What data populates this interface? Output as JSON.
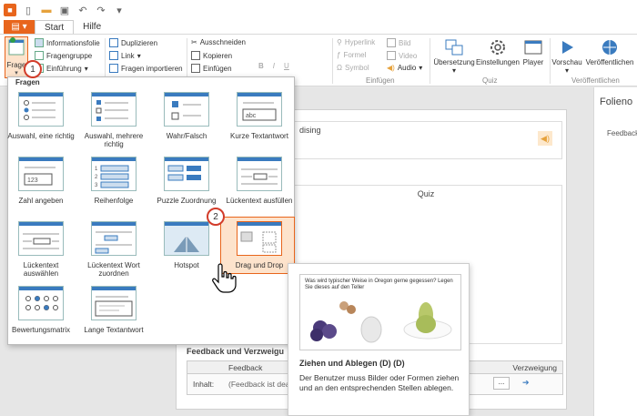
{
  "tabs": {
    "start": "Start",
    "help": "Hilfe"
  },
  "ribbon": {
    "question_btn": "Frage",
    "info_slide": "Informationsfolie",
    "question_group": "Fragengruppe",
    "intro": "Einführung",
    "duplicate": "Duplizieren",
    "link": "Link",
    "import_questions": "Fragen importieren",
    "cut": "Ausschneiden",
    "copy": "Kopieren",
    "paste": "Einfügen",
    "hyperlink": "Hyperlink",
    "formula": "Formel",
    "symbol": "Symbol",
    "image": "Bild",
    "video": "Video",
    "audio": "Audio",
    "insert_group": "Einfügen",
    "translation": "Übersetzung",
    "settings": "Einstellungen",
    "player": "Player",
    "quiz_group": "Quiz",
    "preview": "Vorschau",
    "publish": "Veröffentlichen",
    "publish_group": "Veröffentlichen",
    "bold": "B",
    "italic": "I",
    "underline": "U"
  },
  "panel": {
    "title": "Fragen",
    "tiles": [
      "Auswahl, eine richtig",
      "Auswahl, mehrere richtig",
      "Wahr/Falsch",
      "Kurze Textantwort",
      "Zahl angeben",
      "Reihenfolge",
      "Puzzle Zuordnung",
      "Lückentext ausfüllen",
      "Lückentext auswählen",
      "Lückentext Wort zuordnen",
      "Hotspot",
      "Drag und Drop",
      "Bewertungsmatrix",
      "Lange Textantwort"
    ]
  },
  "markers": {
    "one": "1",
    "two": "2"
  },
  "slide": {
    "partial_text": "dising",
    "quiz_label": "Quiz",
    "feedback_title": "Feedback und Verzweigu",
    "feedback_col": "Feedback",
    "branch_col": "Verzweigung",
    "content_label": "Inhalt:",
    "content_placeholder": "(Feedback ist dea",
    "dots_btn": "...",
    "arrow": "➔"
  },
  "right_panel": {
    "title": "Folieno",
    "feedback": "Feedback"
  },
  "tooltip": {
    "question": "Was wird typischer Weise in Oregon gerne gegessen? Legen Sie dieses auf den Teller",
    "title": "Ziehen und Ablegen (D) (D)",
    "description": "Der Benutzer muss Bilder oder Formen ziehen und an den entsprechenden Stellen ablegen."
  },
  "colors": {
    "accent": "#e8651c",
    "marker": "#d23c2a",
    "blue": "#3a7bbf"
  }
}
